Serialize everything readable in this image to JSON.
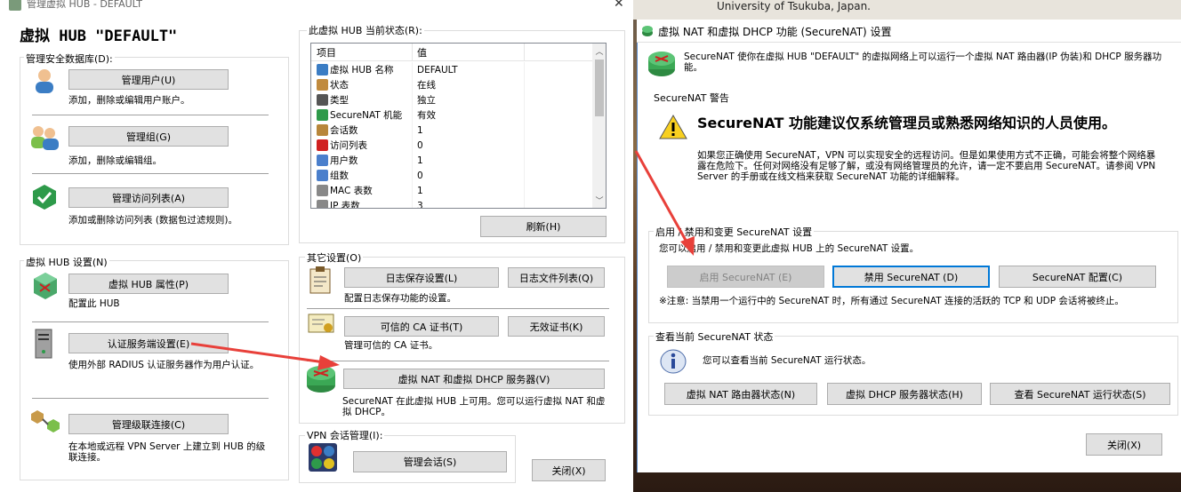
{
  "left_window": {
    "title": "管理虚拟 HUB - DEFAULT",
    "heading": "虚拟 HUB \"DEFAULT\"",
    "security_db": {
      "label": "管理安全数据库(D):",
      "manage_users_button": "管理用户(U)",
      "manage_users_desc": "添加，删除或编辑用户账户。",
      "manage_groups_button": "管理组(G)",
      "manage_groups_desc": "添加，删除或编辑组。",
      "manage_access_button": "管理访问列表(A)",
      "manage_access_desc": "添加或删除访问列表 (数据包过滤规则)。"
    },
    "hub_settings": {
      "label": "虚拟 HUB 设置(N)",
      "properties_button": "虚拟 HUB 属性(P)",
      "properties_desc": "配置此 HUB",
      "radius_button": "认证服务端设置(E)",
      "radius_desc": "使用外部 RADIUS 认证服务器作为用户认证。",
      "cascade_button": "管理级联连接(C)",
      "cascade_desc": "在本地或远程 VPN Server 上建立到 HUB 的级联连接。"
    },
    "status": {
      "label": "此虚拟 HUB 当前状态(R):",
      "col_item": "项目",
      "col_value": "值",
      "rows": [
        {
          "item": "虚拟 HUB 名称",
          "value": "DEFAULT",
          "color": "#3b7dc4"
        },
        {
          "item": "状态",
          "value": "在线",
          "color": "#c08a3e"
        },
        {
          "item": "类型",
          "value": "独立",
          "color": "#555555"
        },
        {
          "item": "SecureNAT 机能",
          "value": "有效",
          "color": "#2e9a4a"
        },
        {
          "item": "会话数",
          "value": "1",
          "color": "#b8863b"
        },
        {
          "item": "访问列表",
          "value": "0",
          "color": "#d02020"
        },
        {
          "item": "用户数",
          "value": "1",
          "color": "#4a7fcc"
        },
        {
          "item": "组数",
          "value": "0",
          "color": "#4a7fcc"
        },
        {
          "item": "MAC 表数",
          "value": "1",
          "color": "#888888"
        },
        {
          "item": "IP 表数",
          "value": "3",
          "color": "#888888"
        }
      ],
      "refresh_button": "刷新(H)"
    },
    "other": {
      "label": "其它设置(O)",
      "log_save_button": "日志保存设置(L)",
      "log_files_button": "日志文件列表(Q)",
      "log_desc": "配置日志保存功能的设置。",
      "ca_button": "可信的 CA 证书(T)",
      "crl_button": "无效证书(K)",
      "ca_desc": "管理可信的 CA 证书。",
      "nat_button": "虚拟 NAT 和虚拟 DHCP 服务器(V)",
      "nat_desc": "SecureNAT 在此虚拟 HUB 上可用。您可以运行虚拟 NAT 和虚拟 DHCP。"
    },
    "session": {
      "label": "VPN 会话管理(I):",
      "manage_button": "管理会话(S)"
    },
    "close_button": "关闭(X)"
  },
  "right_window": {
    "bg_text": "University of Tsukuba, Japan.",
    "title": "虚拟 NAT 和虚拟 DHCP 功能 (SecureNAT) 设置",
    "intro": "SecureNAT 使你在虚拟 HUB \"DEFAULT\" 的虚拟网络上可以运行一个虚拟 NAT 路由器(IP 伪装)和 DHCP 服务器功能。",
    "warning_label": "SecureNAT 警告",
    "warning_heading": "SecureNAT 功能建议仅系统管理员或熟悉网络知识的人员使用。",
    "warning_body": "如果您正确使用 SecureNAT，VPN 可以实现安全的远程访问。但是如果使用方式不正确，可能会将整个网络暴露在危险下。任何对网络没有足够了解，或没有网络管理员的允许，请一定不要启用 SecureNAT。请参阅 VPN Server 的手册或在线文档来获取 SecureNAT 功能的详细解释。",
    "toggle_label": "启用 / 禁用和变更 SecureNAT 设置",
    "toggle_desc": "您可以启用 / 禁用和变更此虚拟 HUB 上的 SecureNAT 设置。",
    "enable_button": "启用 SecureNAT (E)",
    "disable_button": "禁用 SecureNAT (D)",
    "config_button": "SecureNAT 配置(C)",
    "note": "※注意: 当禁用一个运行中的 SecureNAT 时，所有通过 SecureNAT 连接的活跃的 TCP 和 UDP 会话将被终止。",
    "status_label": "查看当前 SecureNAT 状态",
    "status_desc": "您可以查看当前 SecureNAT 运行状态。",
    "nat_status_button": "虚拟 NAT 路由器状态(N)",
    "dhcp_status_button": "虚拟 DHCP 服务器状态(H)",
    "run_status_button": "查看 SecureNAT 运行状态(S)",
    "close_button": "关闭(X)"
  },
  "colors": {
    "focus_border": "#0078d7",
    "arrow": "#e8403a",
    "title_accent": "#2e9a4a"
  }
}
